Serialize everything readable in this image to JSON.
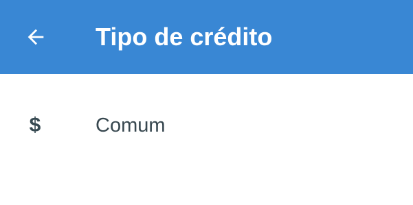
{
  "header": {
    "back_icon": "arrow-left-icon",
    "title": "Tipo de crédito",
    "background_color": "#3987d4"
  },
  "credit_types": [
    {
      "icon": "dollar-icon",
      "icon_glyph": "$",
      "label": "Comum"
    }
  ]
}
